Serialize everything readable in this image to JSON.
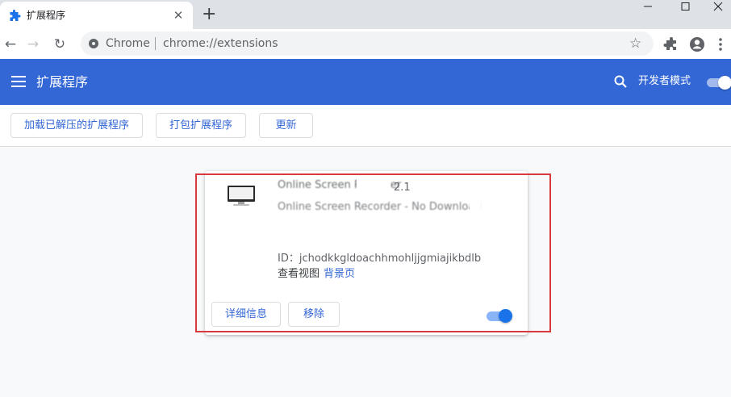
{
  "browser": {
    "tab_title": "扩展程序",
    "new_tab_label": "+",
    "omnibox_site_label": "Chrome",
    "omnibox_url": "chrome://extensions"
  },
  "header": {
    "title": "扩展程序",
    "dev_mode_label": "开发者模式",
    "dev_mode_enabled": true
  },
  "toolbar_buttons": {
    "load_unpacked": "加载已解压的扩展程序",
    "pack": "打包扩展程序",
    "update": "更新"
  },
  "extension": {
    "name": "Online Screen Recorder",
    "version": "2.1",
    "description": "Online Screen Recorder - No Download",
    "id_text": "ID：jchodkkgldoachhmohljjgmiajikbdlb",
    "views_label": "查看视图",
    "views_link": "背景页",
    "details_label": "详细信息",
    "remove_label": "移除",
    "enabled": true
  },
  "colors": {
    "header_blue": "#3367d6",
    "accent_blue": "#1a73e8",
    "highlight_red": "#d9393c"
  }
}
